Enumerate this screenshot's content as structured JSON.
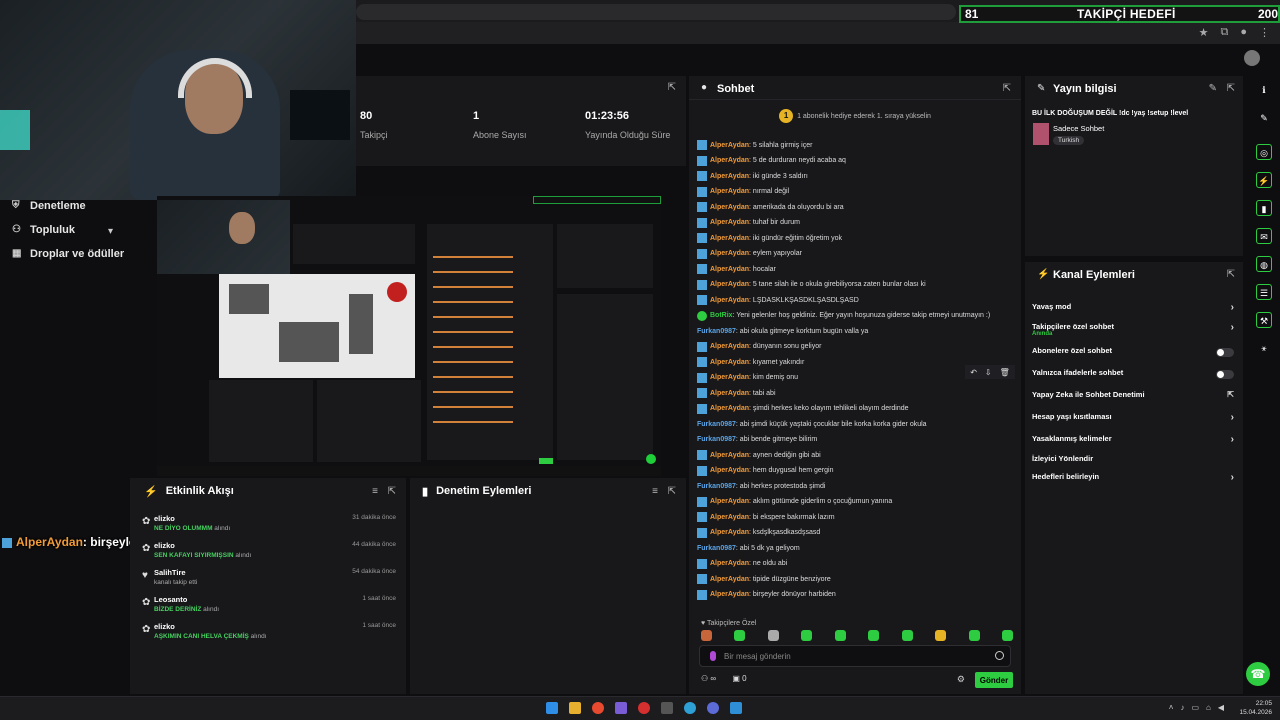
{
  "goal": {
    "current": "81",
    "label": "TAKİPÇİ HEDEFİ",
    "target": "200"
  },
  "nav": {
    "items": [
      {
        "label": "Denetleme",
        "icon": "shield-icon"
      },
      {
        "label": "Topluluk",
        "icon": "community-icon"
      },
      {
        "label": "Droplar ve ödüller",
        "icon": "gift-icon"
      }
    ]
  },
  "stats": [
    {
      "value": "80",
      "label": "Takipçi"
    },
    {
      "value": "1",
      "label": "Abone Sayısı"
    },
    {
      "value": "01:23:56",
      "label": "Yayında Olduğu Süre"
    }
  ],
  "overlay_chat": {
    "user": "AlperAydan",
    "text": ": birşeyler dönüyor harbiden"
  },
  "activity": {
    "title": "Etkinlik Akışı",
    "items": [
      {
        "name": "elizko",
        "highlight": "NE DİYO OLUMMM",
        "suffix": " alındı",
        "time": "31 dakika önce",
        "icon": "gift-icon"
      },
      {
        "name": "elizko",
        "highlight": "SEN KAFAYI SIYIRMIŞSIN",
        "suffix": " alındı",
        "time": "44 dakika önce",
        "icon": "gift-icon"
      },
      {
        "name": "SalihTire",
        "highlight": "",
        "suffix": "kanalı takip etti",
        "time": "54 dakika önce",
        "icon": "heart-icon"
      },
      {
        "name": "Leosanto",
        "highlight": "BİZDE DERİNİZ",
        "suffix": " alındı",
        "time": "1 saat önce",
        "icon": "gift-icon"
      },
      {
        "name": "elizko",
        "highlight": "AŞKIMIN CANI HELVA ÇEKMİŞ",
        "suffix": " alındı",
        "time": "1 saat önce",
        "icon": "gift-icon"
      }
    ]
  },
  "moderation": {
    "title": "Denetim Eylemleri"
  },
  "chat": {
    "title": "Sohbet",
    "pinned": "1 abonelik hediye ederek 1. sıraya yükselin",
    "pinned_badge": "1",
    "messages": [
      {
        "user": "AlperAydan",
        "text": ": 5 silahla girmiş içer",
        "color": "orange",
        "badge": "sub"
      },
      {
        "user": "AlperAydan",
        "text": ": 5 de durduran neydi acaba aq",
        "color": "orange",
        "badge": "sub"
      },
      {
        "user": "AlperAydan",
        "text": ": iki günde 3 saldırı",
        "color": "orange",
        "badge": "sub"
      },
      {
        "user": "AlperAydan",
        "text": ": nırmal değil",
        "color": "orange",
        "badge": "sub"
      },
      {
        "user": "AlperAydan",
        "text": ": amerikada da oluyordu bi ara",
        "color": "orange",
        "badge": "sub"
      },
      {
        "user": "AlperAydan",
        "text": ": tuhaf bir durum",
        "color": "orange",
        "badge": "sub"
      },
      {
        "user": "AlperAydan",
        "text": ": iki gündür eğitim öğretim yok",
        "color": "orange",
        "badge": "sub"
      },
      {
        "user": "AlperAydan",
        "text": ": eylem yapıyolar",
        "color": "orange",
        "badge": "sub"
      },
      {
        "user": "AlperAydan",
        "text": ": hocalar",
        "color": "orange",
        "badge": "sub"
      },
      {
        "user": "AlperAydan",
        "text": ": 5 tane silah ile o okula girebiliyorsa zaten bunlar olası ki",
        "color": "orange",
        "badge": "sub"
      },
      {
        "user": "AlperAydan",
        "text": ": LŞDASKLKŞASDKLŞASDLŞASD",
        "color": "orange",
        "badge": "sub"
      },
      {
        "user": "BotRix",
        "text": ": Yeni gelenler hoş geldiniz. Eğer yayın hoşunuza giderse takip etmeyi unutmayın :)",
        "color": "green",
        "badge": "bot"
      },
      {
        "user": "Furkan0987",
        "text": ": abi okula gitmeye korktum bugün valla ya",
        "color": "blue",
        "badge": "none"
      },
      {
        "user": "AlperAydan",
        "text": ": dünyanın sonu geliyor",
        "color": "orange",
        "badge": "sub"
      },
      {
        "user": "AlperAydan",
        "text": ": kıyamet yakındır",
        "color": "orange",
        "badge": "sub"
      },
      {
        "user": "AlperAydan",
        "text": ": kim demiş onu",
        "color": "orange",
        "badge": "sub"
      },
      {
        "user": "AlperAydan",
        "text": ": tabi abi",
        "color": "orange",
        "badge": "sub"
      },
      {
        "user": "AlperAydan",
        "text": ": şimdi herkes keko olayım tehlikeli olayım derdinde",
        "color": "orange",
        "badge": "sub"
      },
      {
        "user": "Furkan0987",
        "text": ": abi şimdi küçük yaştaki çocuklar bile korka korka gider okula",
        "color": "blue",
        "badge": "none"
      },
      {
        "user": "Furkan0987",
        "text": ": abi bende gitmeye bilirim",
        "color": "blue",
        "badge": "none"
      },
      {
        "user": "AlperAydan",
        "text": ": aynen dediğin gibi abi",
        "color": "orange",
        "badge": "sub"
      },
      {
        "user": "AlperAydan",
        "text": ": hem duygusal hem gergin",
        "color": "orange",
        "badge": "sub"
      },
      {
        "user": "Furkan0987",
        "text": ": abi herkes protestoda şimdi",
        "color": "blue",
        "badge": "none"
      },
      {
        "user": "AlperAydan",
        "text": ": aklım götümde giderlim o çocuğumun yanına",
        "color": "orange",
        "badge": "sub"
      },
      {
        "user": "AlperAydan",
        "text": ": bi ekspere bakırmak lazım",
        "color": "orange",
        "badge": "sub"
      },
      {
        "user": "AlperAydan",
        "text": ": ksdşlkşasdkasdşsasd",
        "color": "orange",
        "badge": "sub"
      },
      {
        "user": "Furkan0987",
        "text": ": abi 5 dk ya geliyom",
        "color": "blue",
        "badge": "none"
      },
      {
        "user": "AlperAydan",
        "text": ": ne oldu abi",
        "color": "orange",
        "badge": "sub"
      },
      {
        "user": "AlperAydan",
        "text": ": tipide düzgüne benziyore",
        "color": "orange",
        "badge": "sub"
      },
      {
        "user": "AlperAydan",
        "text": ": birşeyler dönüyor harbiden",
        "color": "orange",
        "badge": "sub"
      }
    ],
    "sub_only_label": "♥ Takipçilere Özel",
    "input_placeholder": "Bir mesaj gönderin",
    "viewers": "∞",
    "count": "0",
    "send_label": "Gönder"
  },
  "stream_info": {
    "title_label": "Yayın bilgisi",
    "stream_title": "BU İLK DOĞUŞUM DEĞİL !dc !yaş !setup !level",
    "category": "Sadece Sohbet",
    "tag": "Turkish"
  },
  "channel_actions": {
    "title": "Kanal Eylemleri",
    "items": [
      {
        "label": "Yavaş mod",
        "type": "arrow",
        "sub": ""
      },
      {
        "label": "Takipçilere özel sohbet",
        "type": "arrow",
        "sub": "Anında"
      },
      {
        "label": "Abonelere özel sohbet",
        "type": "toggle",
        "sub": ""
      },
      {
        "label": "Yalnızca ifadelerle sohbet",
        "type": "toggle",
        "sub": ""
      },
      {
        "label": "Yapay Zeka ile Sohbet Denetimi",
        "type": "external",
        "sub": ""
      },
      {
        "label": "Hesap yaşı kısıtlaması",
        "type": "arrow",
        "sub": ""
      },
      {
        "label": "Yasaklanmış kelimeler",
        "type": "arrow",
        "sub": ""
      },
      {
        "label": "İzleyici Yönlendir",
        "type": "none",
        "sub": ""
      },
      {
        "label": "Hedefleri belirleyin",
        "type": "arrow",
        "sub": ""
      }
    ]
  },
  "taskbar": {
    "time": "22:05",
    "date": "15.04.2026"
  },
  "colors": {
    "accent": "#2ecc40",
    "username": "#f29b38",
    "username_blue": "#5aa4e6",
    "panel": "#18181b"
  }
}
